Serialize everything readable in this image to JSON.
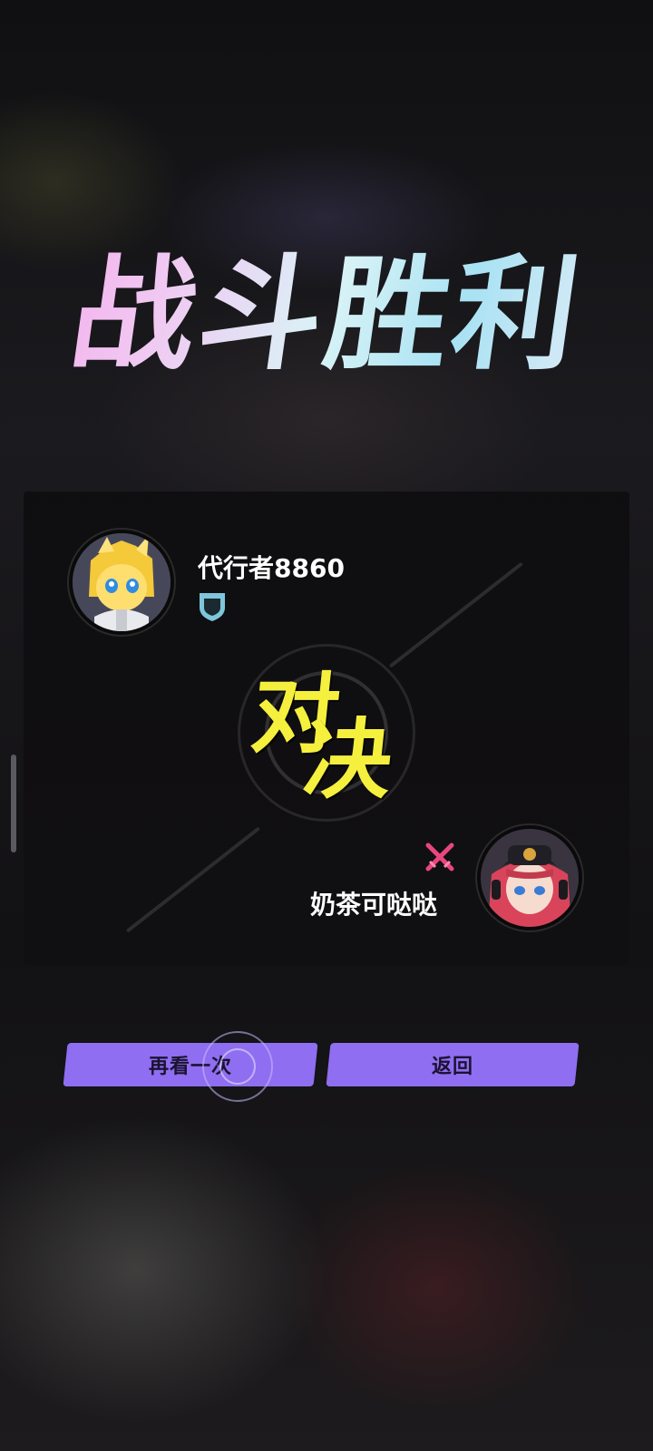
{
  "screen": {
    "title": "战斗胜利",
    "versus_chars": [
      "对",
      "决"
    ]
  },
  "player_one": {
    "name": "代行者8860",
    "avatar_icon": "blonde-hero-avatar",
    "badge_icon": "shield-rank-icon"
  },
  "player_two": {
    "name": "奶茶可哒哒",
    "avatar_icon": "red-hair-girl-avatar",
    "badge_icon": "crossed-swords-icon"
  },
  "actions": {
    "replay_label": "再看一次",
    "back_label": "返回"
  },
  "colors": {
    "button": "#8f6ef1",
    "versus_text": "#f5f03e",
    "shield": "#7fc6dc",
    "swords": "#e8467f",
    "title_gradient": [
      "#f6a6ea",
      "#d9f3f6",
      "#a8e2f3"
    ]
  }
}
